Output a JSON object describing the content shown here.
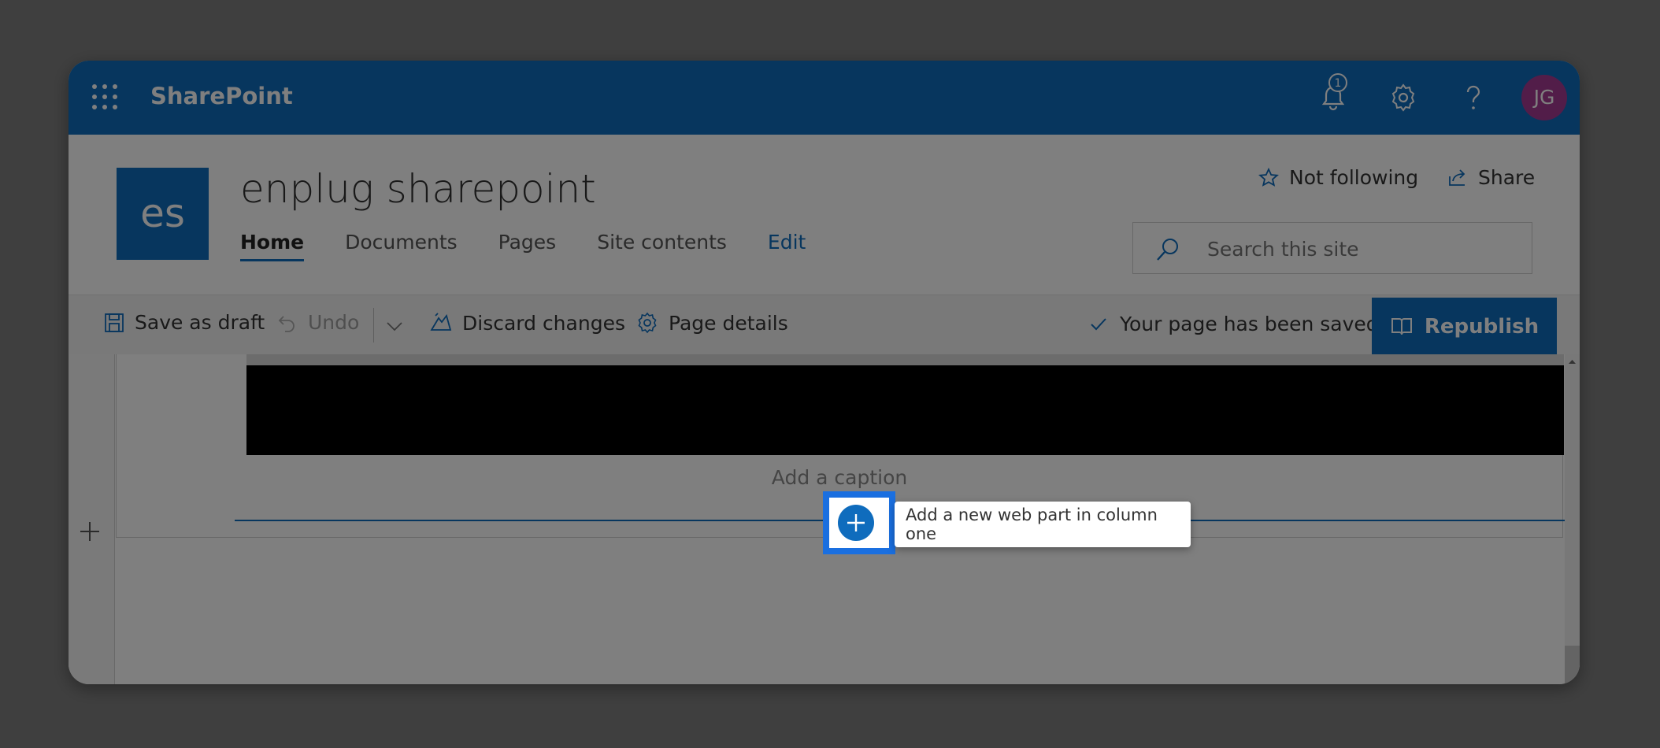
{
  "app": {
    "title": "SharePoint"
  },
  "suitebar": {
    "notification_count": "1",
    "avatar_initials": "JG"
  },
  "site": {
    "logo_text": "es",
    "title": "enplug sharepoint",
    "nav": [
      "Home",
      "Documents",
      "Pages",
      "Site contents",
      "Edit"
    ],
    "follow_label": "Not following",
    "share_label": "Share",
    "search_placeholder": "Search this site"
  },
  "commandbar": {
    "save_draft": "Save as draft",
    "undo": "Undo",
    "discard": "Discard changes",
    "page_details": "Page details",
    "status": "Your page has been saved",
    "republish": "Republish"
  },
  "canvas": {
    "caption_placeholder": "Add a caption",
    "tooltip": "Add a new web part in column one"
  },
  "colors": {
    "brand": "#0f6cbd",
    "avatar": "#a43b93",
    "highlight": "#1a6fe0"
  }
}
